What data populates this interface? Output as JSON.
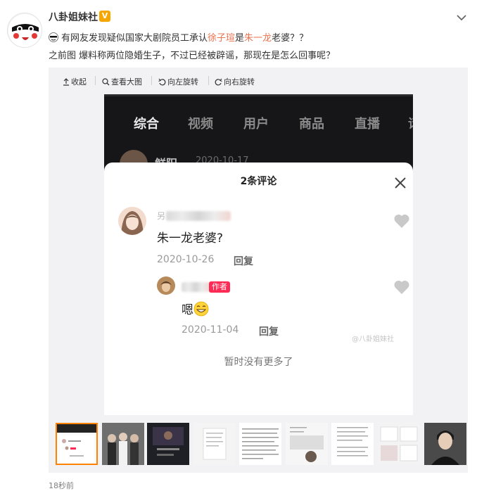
{
  "user": {
    "name": "八卦姐妹社",
    "verified_badge": "V"
  },
  "post": {
    "line1_prefix": "有网友发现疑似国家大剧院员工承认",
    "line1_link1": "徐子瑄",
    "line1_mid": "是",
    "line1_link2": "朱一龙",
    "line1_suffix": "老婆？？",
    "line2": "之前图 爆料称两位隐婚生子，不过已经被辟谣，那现在是怎么回事呢？",
    "timestamp": "18秒前"
  },
  "toolbar": {
    "collapse": "收起",
    "view_large": "查看大图",
    "rotate_left": "向左旋转",
    "rotate_right": "向右旋转"
  },
  "screenshot": {
    "tabs": [
      "综合",
      "视频",
      "用户",
      "商品",
      "直播",
      "话"
    ],
    "active_tab": 0,
    "dim_user_name": "鲜阳",
    "dim_user_date": "2020-10-17",
    "sheet_title": "2条评论",
    "comment1": {
      "name_partial": "另",
      "text": "朱一龙老婆?",
      "date": "2020-10-26",
      "reply": "回复"
    },
    "comment2": {
      "author_tag": "作者",
      "text": "嗯",
      "date": "2020-11-04",
      "reply": "回复"
    },
    "no_more": "暂时没有更多了",
    "watermark": "@八卦姐妹社"
  },
  "thumbnails": {
    "count": 9,
    "selected_index": 0
  },
  "colors": {
    "link": "#eb7350",
    "verified": "#f7a600",
    "author_tag": "#fe2c55",
    "thumb_selected": "#ff8200"
  },
  "icons": [
    "mask-emoji-avatar",
    "verified-icon",
    "chevron-down-icon",
    "face-emoji-icon",
    "collapse-icon",
    "search-icon",
    "rotate-left-icon",
    "rotate-right-icon",
    "close-icon",
    "heart-icon",
    "grin-emoji-icon"
  ]
}
